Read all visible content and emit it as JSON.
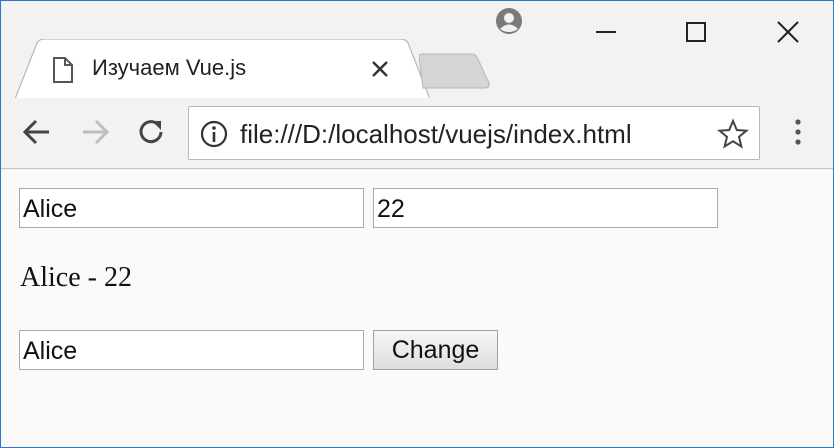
{
  "browser": {
    "tab": {
      "title": "Изучаем Vue.js",
      "favicon": "page-icon"
    },
    "address_bar": {
      "url": "file:///D:/localhost/vuejs/index.html"
    },
    "icons": {
      "back": "arrow-left-icon",
      "forward": "arrow-right-icon",
      "reload": "reload-icon",
      "info": "info-icon",
      "bookmark": "star-icon",
      "menu": "three-dots-icon",
      "profile": "user-icon"
    }
  },
  "page": {
    "name_input": {
      "value": "Alice"
    },
    "age_input": {
      "value": "22"
    },
    "output": "Alice - 22",
    "change_input": {
      "value": "Alice"
    },
    "change_button_label": "Change"
  },
  "colors": {
    "window_border": "#2b78c5",
    "chrome_bg": "#f2f2f2",
    "page_bg": "#fafafa"
  }
}
